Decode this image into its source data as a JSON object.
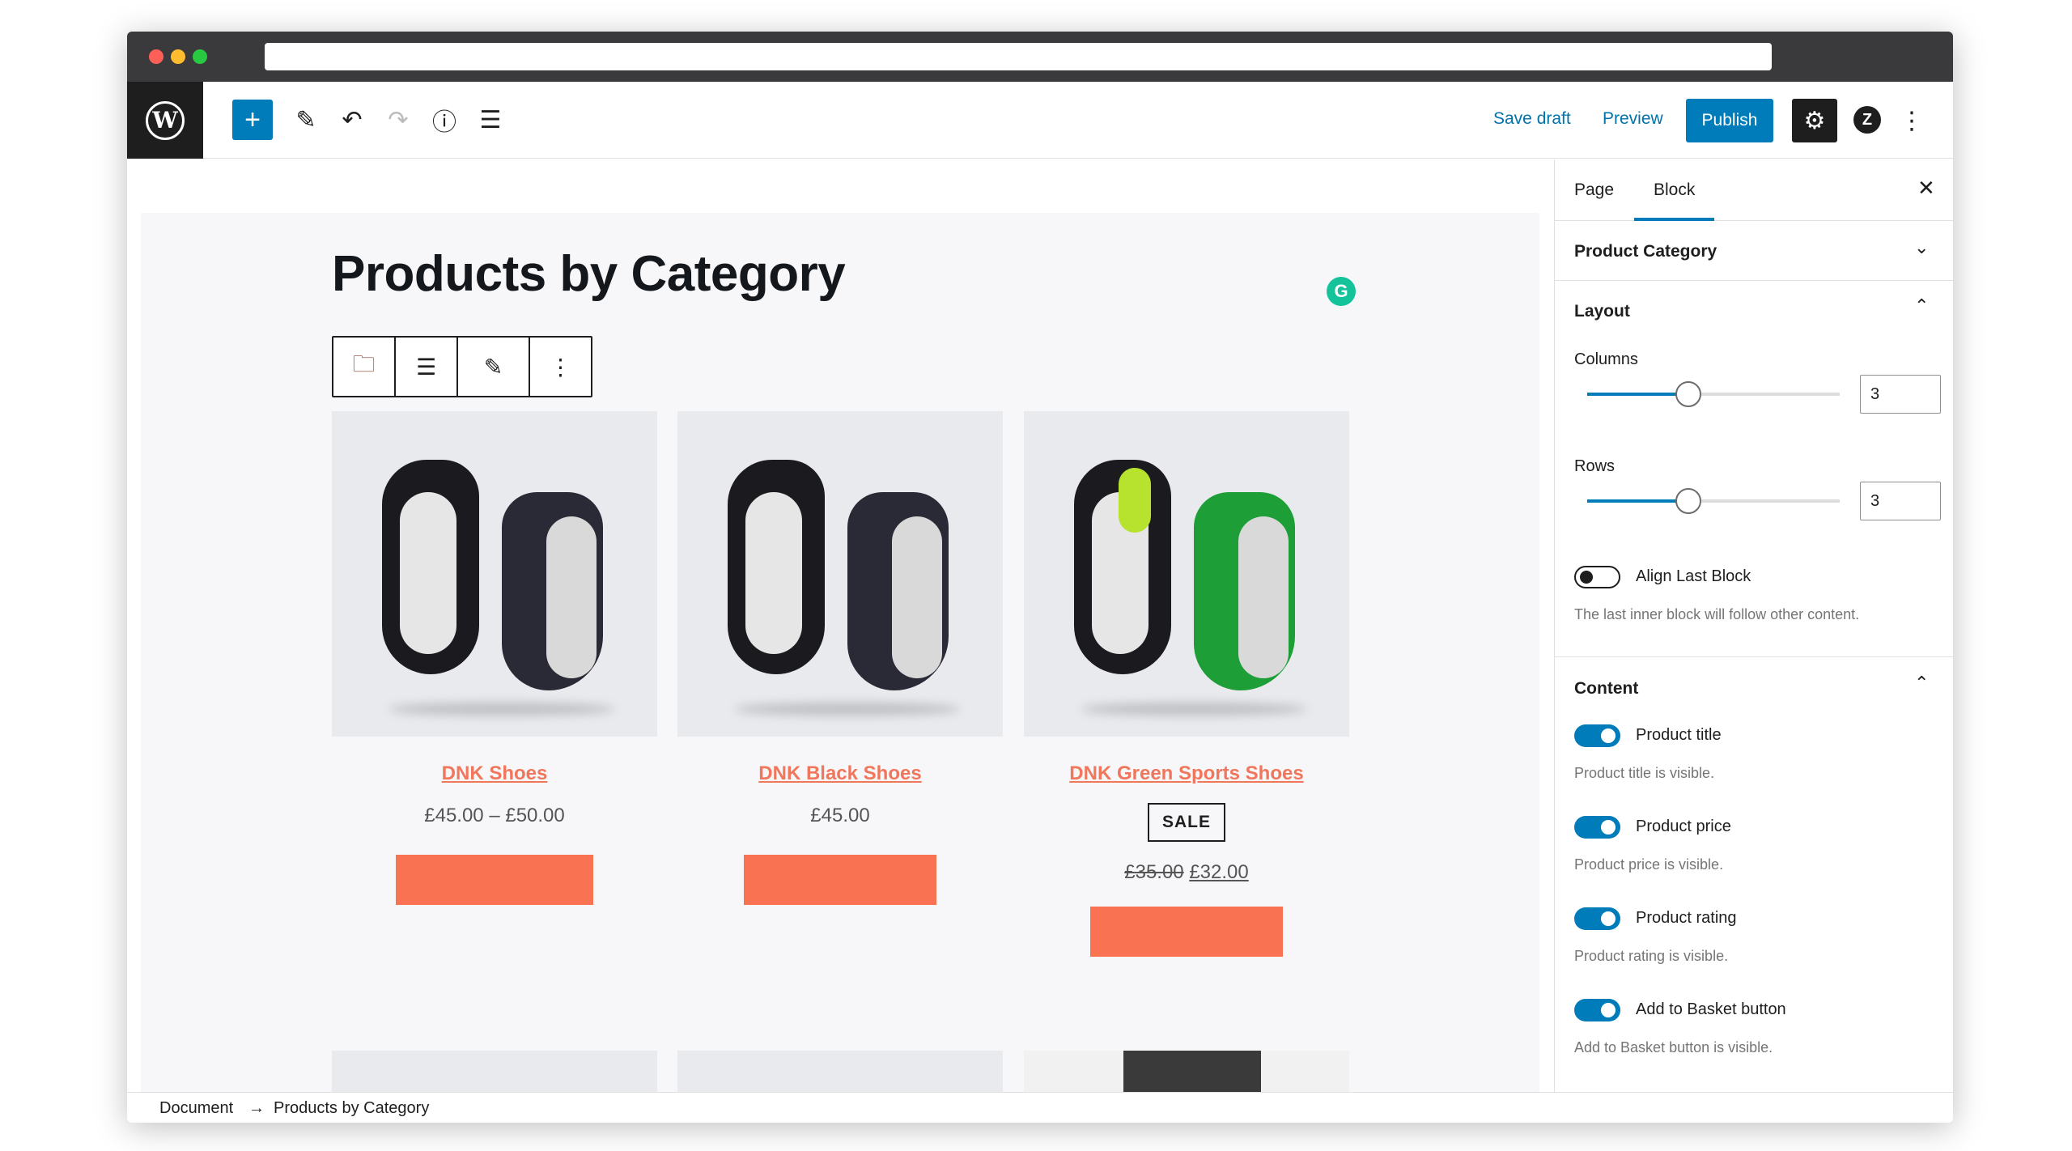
{
  "topbar": {
    "save_draft": "Save draft",
    "preview": "Preview",
    "publish": "Publish",
    "icons": [
      "wordpress-logo",
      "plus",
      "pencil",
      "undo",
      "redo",
      "info",
      "list-view",
      "gear",
      "plugin",
      "more-vertical"
    ]
  },
  "editor": {
    "page_title": "Products by Category",
    "block_toolbar": [
      "folder-icon",
      "align-icon",
      "edit-icon",
      "more-icon"
    ],
    "products": [
      {
        "name": "DNK Shoes",
        "price": "£45.00 – £50.00"
      },
      {
        "name": "DNK Black Shoes",
        "price": "£45.00"
      },
      {
        "name": "DNK Green Sports Shoes",
        "badge": "SALE",
        "old_price": "£35.00",
        "new_price": "£32.00"
      }
    ]
  },
  "sidebar": {
    "tabs": [
      "Page",
      "Block"
    ],
    "active_tab": "Block",
    "product_category": "Product Category",
    "layout": {
      "heading": "Layout",
      "columns_label": "Columns",
      "columns_value": "3",
      "columns_level": 0.4,
      "rows_label": "Rows",
      "rows_value": "3",
      "rows_level": 0.4,
      "align_label": "Align Last Block",
      "align_help": "The last inner block will follow other content."
    },
    "content": {
      "heading": "Content",
      "toggles": [
        {
          "label": "Product title",
          "help": "Product title is visible."
        },
        {
          "label": "Product price",
          "help": "Product price is visible."
        },
        {
          "label": "Product rating",
          "help": "Product rating is visible."
        },
        {
          "label": "Add to Basket button",
          "help": "Add to Basket button is visible."
        }
      ]
    }
  },
  "footer": {
    "crumb_root": "Document",
    "crumb_current": "Products by Category"
  },
  "colors": {
    "accent": "#007cba",
    "product_link": "#f0765c",
    "cart_button": "#f97352"
  }
}
